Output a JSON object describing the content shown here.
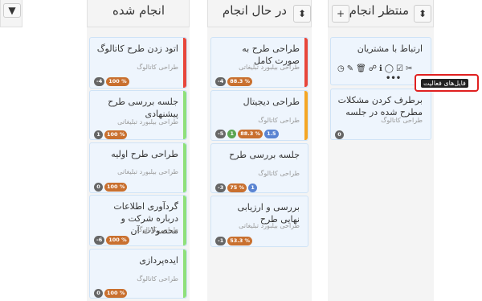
{
  "board": {
    "filter_button": "▼",
    "columns": [
      {
        "title": "منتظر انجام",
        "add_label": "+",
        "sort_label": "⬍"
      },
      {
        "title": "در حال انجام",
        "sort_label": "⬍"
      },
      {
        "title": "انجام شده"
      }
    ]
  },
  "waiting": [
    {
      "title": "ارتباط با مشتریان",
      "tooltip": "فایل‌های فعالیت",
      "more": "•••"
    },
    {
      "title": "برطرف کردن مشکلات مطرح شده در جلسه",
      "sub": "طراحی کاتالوگ",
      "b1": "0"
    }
  ],
  "in_progress": [
    {
      "title": "طراحی طرح به صورت کامل",
      "sub": "طراحی بیلبورد تبلیغاتی",
      "b1": "-4",
      "b2": "88.3 %"
    },
    {
      "title": "طراحی دیجیتال",
      "sub": "طراحی کاتالوگ",
      "b1": "-5",
      "b2": "1",
      "b3": "88.3 %",
      "b4": "1.5"
    },
    {
      "title": "جلسه بررسی طرح",
      "sub": "طراحی کاتالوگ",
      "b1": "-3",
      "b2": "75 %",
      "b3": "1"
    },
    {
      "title": "بررسی و ارزیابی نهایی طرح",
      "sub": "طراحی بیلبورد تبلیغاتی",
      "b1": "-1",
      "b2": "53.3 %"
    }
  ],
  "done": [
    {
      "title": "اتود زدن طرح کاتالوگ",
      "sub": "طراحی کاتالوگ",
      "b1": "-4",
      "b2": "100 %"
    },
    {
      "title": "جلسه بررسی طرح پیشنهادی",
      "sub": "طراحی بیلبورد تبلیغاتی",
      "b1": "1",
      "b2": "100 %"
    },
    {
      "title": "طراحی طرح اولیه",
      "sub": "طراحی بیلبورد تبلیغاتی",
      "b1": "0",
      "b2": "100 %"
    },
    {
      "title": "گردآوری اطلاعات درباره شرکت و محصولات آن",
      "sub": "طراحی کاتالوگ",
      "b1": "-6",
      "b2": "100 %"
    },
    {
      "title": "ایده‌پردازی",
      "sub": "طراحی کاتالوگ",
      "b1": "0",
      "b2": "100 %"
    }
  ],
  "colors": {
    "red_bar": "#e8463a",
    "orange_bar": "#f5a623",
    "green_bar": "#8fe07a",
    "card_bg": "#eef5fd"
  },
  "icons": [
    "paperclip-icon",
    "checkbox-icon",
    "comment-icon",
    "comments-icon",
    "info-icon",
    "trash-icon",
    "brush-icon",
    "clock-icon"
  ]
}
